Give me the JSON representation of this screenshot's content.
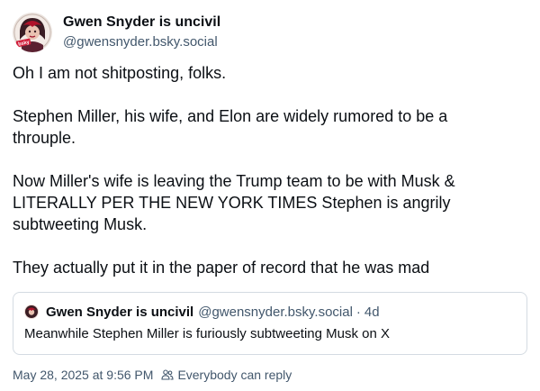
{
  "author": {
    "display_name": "Gwen Snyder is uncivil",
    "handle": "@gwensnyder.bsky.social",
    "avatar_text": "bsky"
  },
  "post": {
    "paragraphs": [
      "Oh I am not shitposting, folks.",
      "Stephen Miller, his wife, and Elon are widely rumored to be a\nthrouple.",
      "Now Miller's wife is leaving the Trump team to be with Musk &\nLITERALLY PER THE NEW YORK TIMES Stephen is angrily\nsubtweeting Musk.",
      "They actually put it in the paper of record that he was mad"
    ]
  },
  "quote": {
    "display_name": "Gwen Snyder is uncivil",
    "handle": "@gwensnyder.bsky.social",
    "separator": "·",
    "time": "4d",
    "text": "Meanwhile Stephen Miller is furiously subtweeting Musk on X"
  },
  "footer": {
    "timestamp": "May 28, 2025 at 9:56 PM",
    "reply_setting": "Everybody can reply",
    "reply_icon": "people-icon"
  },
  "colors": {
    "text": "#0b0f14",
    "muted": "#42576c",
    "border": "#d4dbe2"
  }
}
